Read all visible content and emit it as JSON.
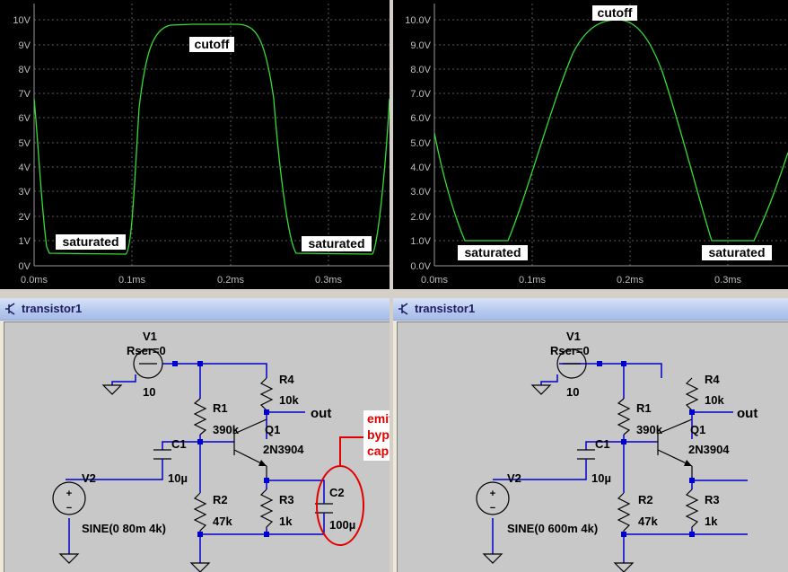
{
  "plot_left": {
    "y_ticks": [
      "10V",
      "9V",
      "8V",
      "7V",
      "6V",
      "5V",
      "4V",
      "3V",
      "2V",
      "1V",
      "0V"
    ],
    "x_ticks": [
      "0.0ms",
      "0.1ms",
      "0.2ms",
      "0.3ms"
    ],
    "labels": {
      "cutoff": "cutoff",
      "saturated_left": "saturated",
      "saturated_right": "saturated"
    }
  },
  "plot_right": {
    "y_ticks": [
      "10.0V",
      "9.0V",
      "8.0V",
      "7.0V",
      "6.0V",
      "5.0V",
      "4.0V",
      "3.0V",
      "2.0V",
      "1.0V",
      "0.0V"
    ],
    "x_ticks": [
      "0.0ms",
      "0.1ms",
      "0.2ms",
      "0.3ms"
    ],
    "labels": {
      "cutoff": "cutoff",
      "saturated_left": "saturated",
      "saturated_right": "saturated"
    }
  },
  "schematic_left": {
    "window_title": "transistor1",
    "v1": {
      "name": "V1",
      "rser": "Rser=0",
      "value": "10"
    },
    "r1": {
      "name": "R1",
      "value": "390k"
    },
    "r2": {
      "name": "R2",
      "value": "47k"
    },
    "r3": {
      "name": "R3",
      "value": "1k"
    },
    "r4": {
      "name": "R4",
      "value": "10k"
    },
    "q1": {
      "name": "Q1",
      "model": "2N3904"
    },
    "c1": {
      "name": "C1",
      "value": "10µ"
    },
    "c2": {
      "name": "C2",
      "value": "100µ"
    },
    "v2": {
      "name": "V2",
      "source": "SINE(0 80m 4k)"
    },
    "out_label": "out",
    "annotation": [
      "emitter",
      "bypass",
      "cap"
    ]
  },
  "schematic_right": {
    "window_title": "transistor1",
    "v1": {
      "name": "V1",
      "rser": "Rser=0",
      "value": "10"
    },
    "r1": {
      "name": "R1",
      "value": "390k"
    },
    "r2": {
      "name": "R2",
      "value": "47k"
    },
    "r3": {
      "name": "R3",
      "value": "1k"
    },
    "r4": {
      "name": "R4",
      "value": "10k"
    },
    "q1": {
      "name": "Q1",
      "model": "2N3904"
    },
    "c1": {
      "name": "C1",
      "value": "10µ"
    },
    "v2": {
      "name": "V2",
      "source": "SINE(0 600m 4k)"
    },
    "out_label": "out"
  },
  "colors": {
    "trace": "#33dd33",
    "wire": "#0000cc",
    "annotation": "#e00000",
    "plot_bg": "#000000",
    "schematic_bg": "#c8c8c8"
  }
}
